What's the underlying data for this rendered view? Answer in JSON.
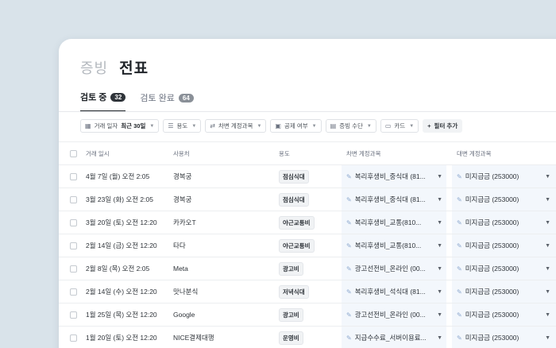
{
  "header": {
    "title_muted": "증빙",
    "title_main": "전표"
  },
  "tabs": [
    {
      "label": "검토 중",
      "count": "32"
    },
    {
      "label": "검토 완료",
      "count": "64"
    }
  ],
  "filters": {
    "date": {
      "label": "거래 일자",
      "value": "최근 30일"
    },
    "usage": "용도",
    "debit_account": "차변 계정과목",
    "deductible": "공제 여부",
    "proof_method": "증빙 수단",
    "card": "카드",
    "add_filter": "필터 추가"
  },
  "table": {
    "columns": {
      "date": "거래 일시",
      "store": "사용처",
      "usage": "용도",
      "debit": "차변 계정과목",
      "credit": "대변 계정과목"
    },
    "rows": [
      {
        "date": "4월 7일 (월) 오전 2:05",
        "store": "경복궁",
        "usage": "점심식대",
        "debit": "복리후생비_중식대 (81...",
        "credit": "미지급금 (253000)"
      },
      {
        "date": "3월 23일 (화) 오전 2:05",
        "store": "경복궁",
        "usage": "점심식대",
        "debit": "복리후생비_중식대 (81...",
        "credit": "미지급금 (253000)"
      },
      {
        "date": "3월 20일 (토) 오전 12:20",
        "store": "카카오T",
        "usage": "야근교통비",
        "debit": "복리후생비_교통(810...",
        "credit": "미지급금 (253000)"
      },
      {
        "date": "2월 14일 (금) 오전 12:20",
        "store": "타다",
        "usage": "야근교통비",
        "debit": "복리후생비_교통(810...",
        "credit": "미지급금 (253000)"
      },
      {
        "date": "2월 8일 (목) 오전 2:05",
        "store": "Meta",
        "usage": "광고비",
        "debit": "광고선전비_온라인 (00...",
        "credit": "미지급금 (253000)"
      },
      {
        "date": "2월 14일 (수) 오전 12:20",
        "store": "맛나분식",
        "usage": "저녁식대",
        "debit": "복리후생비_석식대 (81...",
        "credit": "미지급금 (253000)"
      },
      {
        "date": "1월 25일 (목) 오전 12:20",
        "store": "Google",
        "usage": "광고비",
        "debit": "광고선전비_온라인 (00...",
        "credit": "미지급금 (253000)"
      },
      {
        "date": "1월 20일 (토) 오전 12:20",
        "store": "NICE결제대행",
        "usage": "운영비",
        "debit": "지급수수료_서버이용료...",
        "credit": "미지급금 (253000)"
      }
    ]
  }
}
